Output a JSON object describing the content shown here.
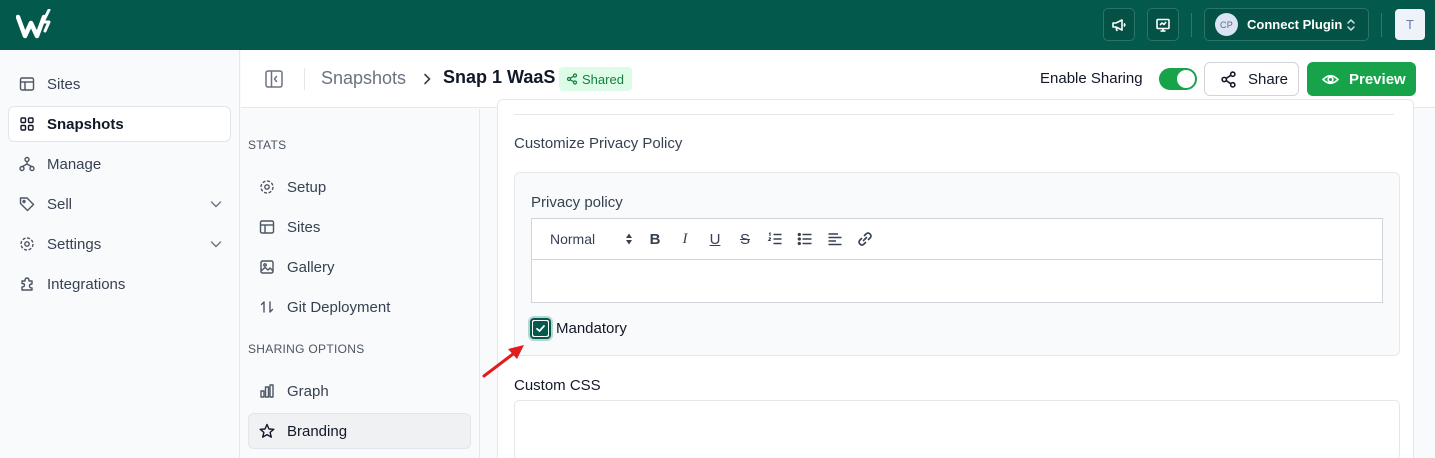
{
  "app": {
    "logo_icon": "w-logo-icon",
    "brand_color": "#04594d",
    "accent_green": "#16a34a"
  },
  "topbar": {
    "connect_badge": "CP",
    "connect_label": "Connect Plugin",
    "user_initial": "T"
  },
  "sidebar": {
    "items": [
      {
        "label": "Sites",
        "icon": "layout-icon"
      },
      {
        "label": "Snapshots",
        "icon": "grid-icon",
        "active": true
      },
      {
        "label": "Manage",
        "icon": "hierarchy-icon"
      },
      {
        "label": "Sell",
        "icon": "tag-icon",
        "expandable": true
      },
      {
        "label": "Settings",
        "icon": "gear-icon",
        "expandable": true
      },
      {
        "label": "Integrations",
        "icon": "puzzle-icon"
      }
    ]
  },
  "header": {
    "breadcrumb_parent": "Snapshots",
    "breadcrumb_current": "Snap 1 WaaS",
    "badge": "Shared",
    "enable_sharing_label": "Enable Sharing",
    "sharing_enabled": true,
    "share_label": "Share",
    "preview_label": "Preview"
  },
  "subnav": {
    "sections": [
      {
        "title": "STATS",
        "items": [
          "Setup",
          "Sites",
          "Gallery",
          "Git Deployment"
        ]
      },
      {
        "title": "SHARING OPTIONS",
        "items": [
          "Graph",
          "Branding"
        ]
      }
    ],
    "active_item": "Branding"
  },
  "main": {
    "section_title": "Customize Privacy Policy",
    "policy_label": "Privacy policy",
    "editor_format": "Normal",
    "editor_value": "",
    "mandatory_label": "Mandatory",
    "mandatory_checked": true,
    "custom_css_label": "Custom CSS",
    "custom_css_value": ""
  }
}
